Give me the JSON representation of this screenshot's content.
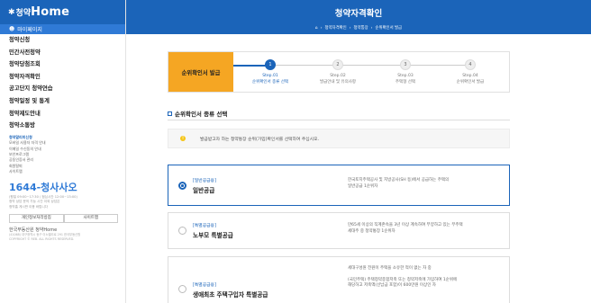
{
  "sidebar": {
    "logo_star": "✱",
    "logo_ko": "청약",
    "logo_en": "Home",
    "my_page": "마이페이지",
    "menu": [
      "청약신청",
      "민간사전청약",
      "청약당첨조회",
      "청약자격확인",
      "공고단지 청약연습",
      "청약일정 및 통계",
      "청약제도안내",
      "청약소통방"
    ],
    "submenu": [
      "청약알리미신청",
      "모바일 사용자 자격 안내",
      "이메일 수신동의 안내",
      "보안프로그램",
      "공동인증서 관리",
      "회원탈퇴",
      "사이트맵"
    ],
    "phone": "1644-청사사오",
    "hours": [
      "(평일 09:00~17:30 / 점심시간 12:00~13:00)",
      "청약 상담 문의 가능 시간 이외 상담은",
      "청약홈 게시판 이용 바랍니다"
    ],
    "buttons": [
      "개인정보처리방침",
      "사이트맵"
    ],
    "footer_brand": "한국부동산원 청약Home",
    "footer_copy": [
      "(41068) 대구광역시 동구 이노밸리로 291 한국부동산원",
      "COPYRIGHT © REB. ALL RIGHTS RESERVED."
    ]
  },
  "banner": {
    "title": "청약자격확인",
    "breadcrumbs": [
      "청약자격확인",
      "청약통장",
      "순위확인서 발급"
    ]
  },
  "stepper": {
    "label": "순위확인서 발급",
    "steps": [
      {
        "num": "1",
        "name": "Step.01",
        "desc": "순위확인서 종류 선택"
      },
      {
        "num": "2",
        "name": "Step.02",
        "desc": "발급안내 및 유의사항"
      },
      {
        "num": "3",
        "name": "Step.03",
        "desc": "주택형 선택"
      },
      {
        "num": "4",
        "name": "Step.04",
        "desc": "순위확인서 발급"
      }
    ],
    "active_step": 1
  },
  "section": {
    "title": "순위확인서 종류 선택",
    "notice": "발급받고자 하는 청약통장 순위(가입)확인서를 선택하여 주십시오."
  },
  "options": [
    {
      "category": "[일반공급용]",
      "name": "일반공급",
      "desc": [
        "한국토지주택공사 및 지방공사(SH 등)에서 공급하는 주택의",
        "일반공급 1순위자"
      ],
      "selected": true
    },
    {
      "category": "[특별공급용]",
      "name": "노부모 특별공급",
      "desc": [
        "만65세 이상의 직계존속을 3년 이상 계속하여 부양하고 있는 무주택",
        "세대주 중 청약통장 1순위자"
      ],
      "selected": false
    },
    {
      "category": "[특별공급용]",
      "name": "생애최초 주택구입자 특별공급",
      "desc": [
        "세대구성원 전원이 주택을 소유한 적이 없는 자 중",
        "(국민주택) 주택청약종합저축 또는 청약저축에 가입하여 1순위에",
        "해당하고 저축액(선납금 포함)이 600만원 이상인 자"
      ],
      "selected": false
    }
  ]
}
